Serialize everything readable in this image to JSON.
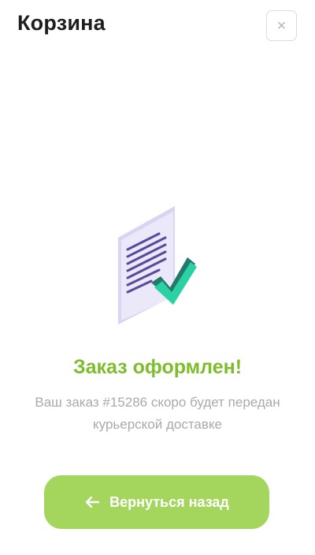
{
  "header": {
    "title": "Корзина",
    "close_icon": "close-icon",
    "close_label": "×"
  },
  "success": {
    "illustration_icon": "document-check-icon",
    "title": "Заказ оформлен!",
    "message": "Ваш заказ #15286 скоро будет передан курьерской доставке"
  },
  "actions": {
    "back_label": "Вернуться назад",
    "back_icon": "arrow-left-icon"
  },
  "colors": {
    "accent_green": "#7dbd2b",
    "button_green": "#a4d65e",
    "doc_purple": "#5a4a9c",
    "check_teal": "#2ad1a3"
  }
}
